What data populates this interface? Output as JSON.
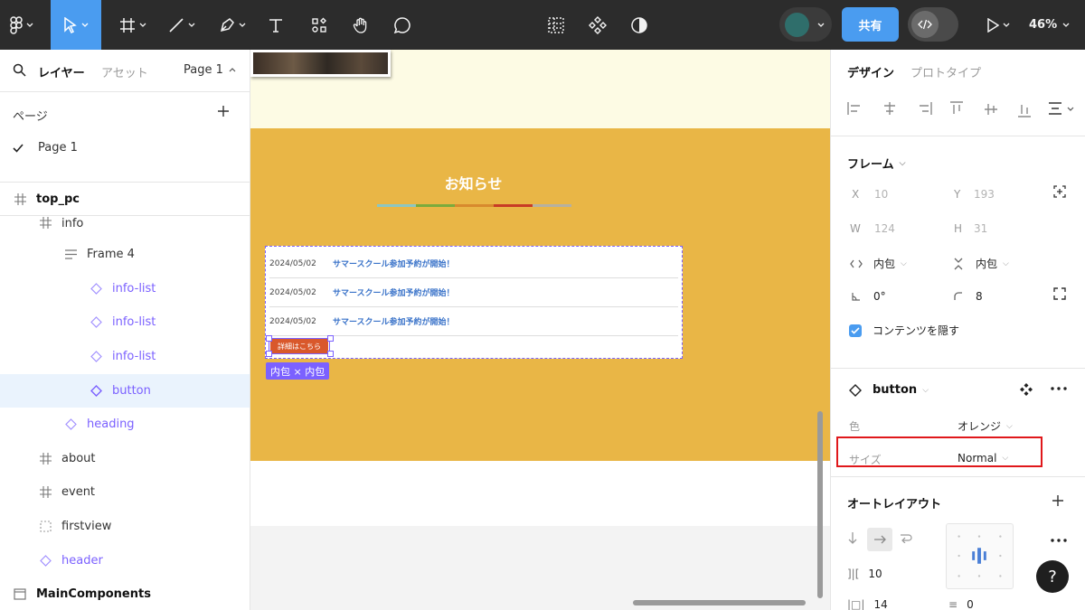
{
  "toolbar": {
    "share_label": "共有",
    "zoom_label": "46%",
    "avatar_color": "#2f6e6b",
    "accent_color": "#4a9cf0"
  },
  "left_panel": {
    "tabs": {
      "layers": "レイヤー",
      "assets": "アセット",
      "page_switch": "Page 1"
    },
    "pages_header": "ページ",
    "pages": [
      {
        "name": "Page 1",
        "selected": true
      }
    ],
    "layers": [
      {
        "name": "top_pc",
        "icon": "frame-icon"
      },
      {
        "name": "info",
        "icon": "frame-icon"
      },
      {
        "name": "Frame 4",
        "icon": "autolayout-icon"
      },
      {
        "name": "info-list",
        "icon": "instance-icon"
      },
      {
        "name": "info-list",
        "icon": "instance-icon"
      },
      {
        "name": "info-list",
        "icon": "instance-icon"
      },
      {
        "name": "button",
        "icon": "instance-icon",
        "selected": true
      },
      {
        "name": "heading",
        "icon": "instance-icon"
      },
      {
        "name": "about",
        "icon": "frame-icon"
      },
      {
        "name": "event",
        "icon": "frame-icon"
      },
      {
        "name": "firstview",
        "icon": "section-icon"
      },
      {
        "name": "header",
        "icon": "instance-icon"
      },
      {
        "name": "MainComponents",
        "icon": "page-icon"
      }
    ]
  },
  "canvas": {
    "news_title": "お知らせ",
    "news_items": [
      {
        "date": "2024/05/02",
        "text": "サマースクール参加予約が開始！"
      },
      {
        "date": "2024/05/02",
        "text": "サマースクール参加予約が開始！"
      },
      {
        "date": "2024/05/02",
        "text": "サマースクール参加予約が開始！"
      }
    ],
    "button_label": "詳細はこちら",
    "size_badge": "内包 × 内包",
    "line_colors": [
      "#8cc6c2",
      "#7bab3c",
      "#d88a2d",
      "#c83c25",
      "#b6b0a0"
    ],
    "section_color": "#e9b646"
  },
  "right_panel": {
    "tabs": {
      "design": "デザイン",
      "prototype": "プロトタイプ"
    },
    "frame": {
      "title": "フレーム",
      "x_key": "X",
      "x_val": "10",
      "y_key": "Y",
      "y_val": "193",
      "w_key": "W",
      "w_val": "124",
      "h_key": "H",
      "h_val": "31",
      "width_mode": "内包",
      "height_mode": "内包",
      "rotation": "0°",
      "radius": "8",
      "clip_label": "コンテンツを隠す"
    },
    "instance": {
      "name": "button",
      "color_key": "色",
      "color_val": "オレンジ",
      "size_key": "サイズ",
      "size_val": "Normal"
    },
    "autolayout": {
      "title": "オートレイアウト",
      "gap": "10",
      "padding": "14",
      "padding_v": "0"
    },
    "help_label": "?"
  }
}
